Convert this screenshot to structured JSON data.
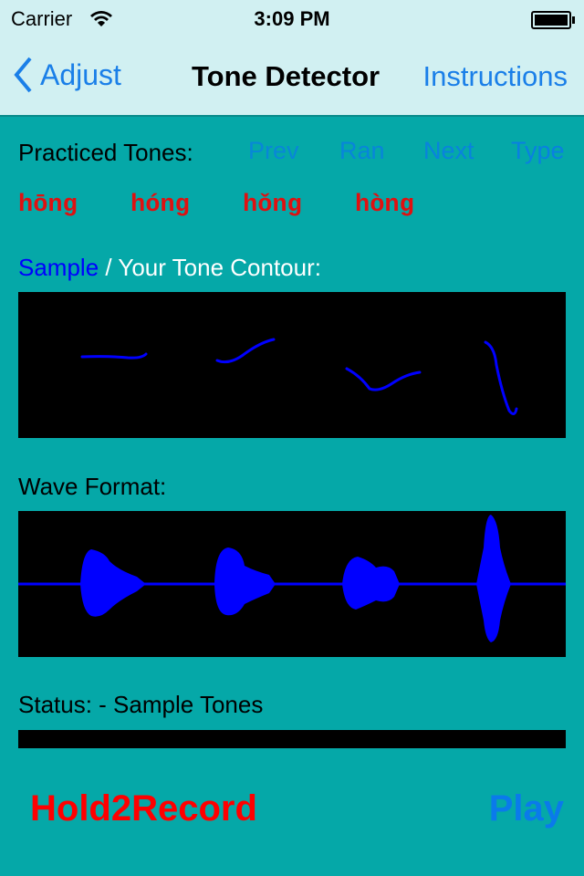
{
  "status_bar": {
    "carrier": "Carrier",
    "time": "3:09 PM"
  },
  "nav": {
    "back_label": "Adjust",
    "title": "Tone Detector",
    "right_label": "Instructions"
  },
  "practiced": {
    "label": "Practiced Tones:",
    "buttons": [
      "Prev",
      "Ran",
      "Next",
      "Type"
    ],
    "tones": [
      "hōng",
      "hóng",
      "hǒng",
      "hòng"
    ]
  },
  "contour": {
    "sample_label": "Sample",
    "rest_label": " / Your Tone Contour:"
  },
  "wave": {
    "label": "Wave Format:"
  },
  "status": {
    "text": "Status:  - Sample Tones"
  },
  "actions": {
    "record": "Hold2Record",
    "play": "Play"
  },
  "colors": {
    "background": "#05a8a8",
    "record": "#ff0000",
    "accent": "#0a7aeb",
    "trace": "#0000ff"
  }
}
